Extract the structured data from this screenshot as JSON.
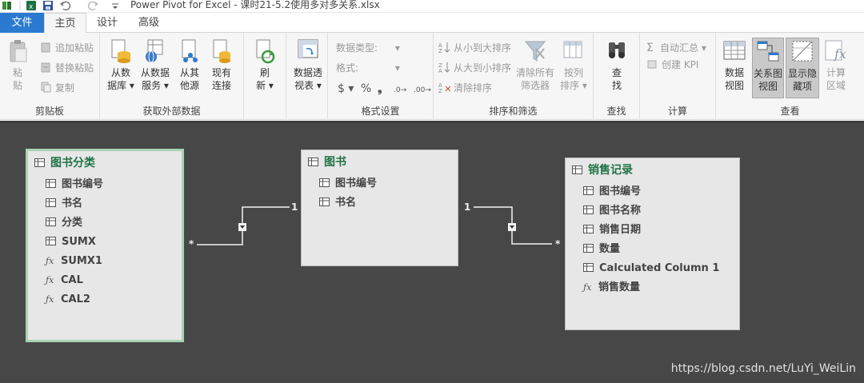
{
  "window": {
    "title": "Power Pivot for Excel - 课时21-5.2使用多对多关系.xlsx"
  },
  "menu_tabs": [
    "文件",
    "主页",
    "设计",
    "高级"
  ],
  "ribbon": {
    "clipboard": {
      "label": "剪贴板",
      "paste_line1": "粘",
      "paste_line2": "贴",
      "append_paste": "追加粘贴",
      "replace_paste": "替换粘贴",
      "copy": "复制"
    },
    "external": {
      "label": "获取外部数据",
      "from_db_line1": "从数",
      "from_db_line2": "据库",
      "from_service_line1": "从数据",
      "from_service_line2": "服务",
      "from_other_line1": "从其",
      "from_other_line2": "他源",
      "existing_line1": "现有",
      "existing_line2": "连接"
    },
    "refresh": {
      "line1": "刷",
      "line2": "新"
    },
    "pivot": {
      "line1": "数据透",
      "line2": "视表"
    },
    "format": {
      "label": "格式设置",
      "data_type": "数据类型:",
      "format": "格式:",
      "currency": "$",
      "percent": "%",
      "comma": "❟",
      "inc_decimal": ".0→.00",
      "dec_decimal": ".00→.0"
    },
    "sort": {
      "label": "排序和筛选",
      "asc": "从小到大排序",
      "desc": "从大到小排序",
      "clear_sort": "清除排序",
      "clear_filter_line1": "清除所有",
      "clear_filter_line2": "筛选器",
      "by_col_line1": "按列",
      "by_col_line2": "排序"
    },
    "find": {
      "label": "查找",
      "line1": "查",
      "line2": "找"
    },
    "calc": {
      "label": "计算",
      "autosum": "自动汇总",
      "create_kpi": "创建 KPI"
    },
    "view": {
      "label": "查看",
      "data_view_line1": "数据",
      "data_view_line2": "视图",
      "diagram_view_line1": "关系图",
      "diagram_view_line2": "视图",
      "show_hidden_line1": "显示隐",
      "show_hidden_line2": "藏项",
      "calc_area_line1": "计算",
      "calc_area_line2": "区域"
    }
  },
  "diagram": {
    "tables": [
      {
        "name": "图书分类",
        "columns": [
          {
            "name": "图书编号",
            "kind": "column"
          },
          {
            "name": "书名",
            "kind": "column"
          },
          {
            "name": "分类",
            "kind": "column"
          },
          {
            "name": "SUMX",
            "kind": "column"
          },
          {
            "name": "SUMX1",
            "kind": "measure"
          },
          {
            "name": "CAL",
            "kind": "measure"
          },
          {
            "name": "CAL2",
            "kind": "measure"
          }
        ]
      },
      {
        "name": "图书",
        "columns": [
          {
            "name": "图书编号",
            "kind": "column"
          },
          {
            "name": "书名",
            "kind": "column"
          }
        ]
      },
      {
        "name": "销售记录",
        "columns": [
          {
            "name": "图书编号",
            "kind": "column"
          },
          {
            "name": "图书名称",
            "kind": "column"
          },
          {
            "name": "销售日期",
            "kind": "column"
          },
          {
            "name": "数量",
            "kind": "column"
          },
          {
            "name": "Calculated Column 1",
            "kind": "column"
          },
          {
            "name": "销售数量",
            "kind": "measure"
          }
        ]
      }
    ],
    "relationships": [
      {
        "from": "图书分类",
        "to": "图书",
        "from_card": "*",
        "to_card": "1"
      },
      {
        "from": "图书",
        "to": "销售记录",
        "from_card": "1",
        "to_card": "*"
      }
    ],
    "watermark": "https://blog.csdn.net/LuYi_WeiLin"
  },
  "icons": {
    "table": "table-icon",
    "measure": "fx-icon"
  },
  "colors": {
    "accent": "#217346",
    "file_tab": "#2b7ad0",
    "canvas": "#474747",
    "selected_border": "#a9d4b4"
  }
}
